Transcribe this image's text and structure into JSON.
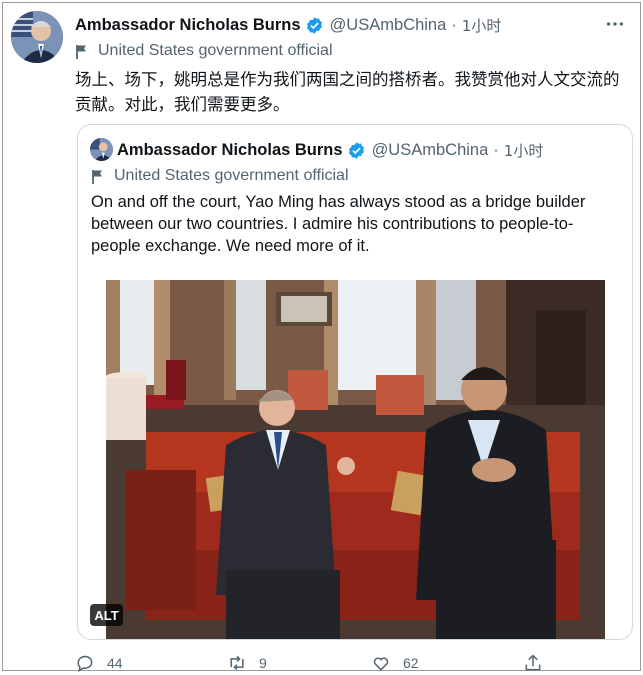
{
  "tweet": {
    "author_name": "Ambassador Nicholas Burns",
    "handle": "@USAmbChina",
    "separator": "·",
    "time": "1小时",
    "label": "United States government official",
    "text": "场上、场下，姚明总是作为我们两国之间的搭桥者。我赞赏他对人文交流的贡献。对此，我们需要更多。"
  },
  "quoted": {
    "author_name": "Ambassador Nicholas Burns",
    "handle": "@USAmbChina",
    "separator": "·",
    "time": "1小时",
    "label": "United States government official",
    "text": "On and off the court, Yao Ming has always stood as a bridge builder between our two countries.  I admire his contributions to people-to-people exchange. We need more of it.",
    "alt_badge": "ALT"
  },
  "actions": {
    "reply_count": "44",
    "retweet_count": "9",
    "like_count": "62"
  },
  "colors": {
    "verified": "#1d9bf0",
    "secondary_text": "#536471",
    "primary_text": "#0f1419"
  },
  "icons": [
    "verified-badge-icon",
    "more-icon",
    "flag-icon",
    "reply-icon",
    "retweet-icon",
    "like-icon",
    "share-icon"
  ]
}
